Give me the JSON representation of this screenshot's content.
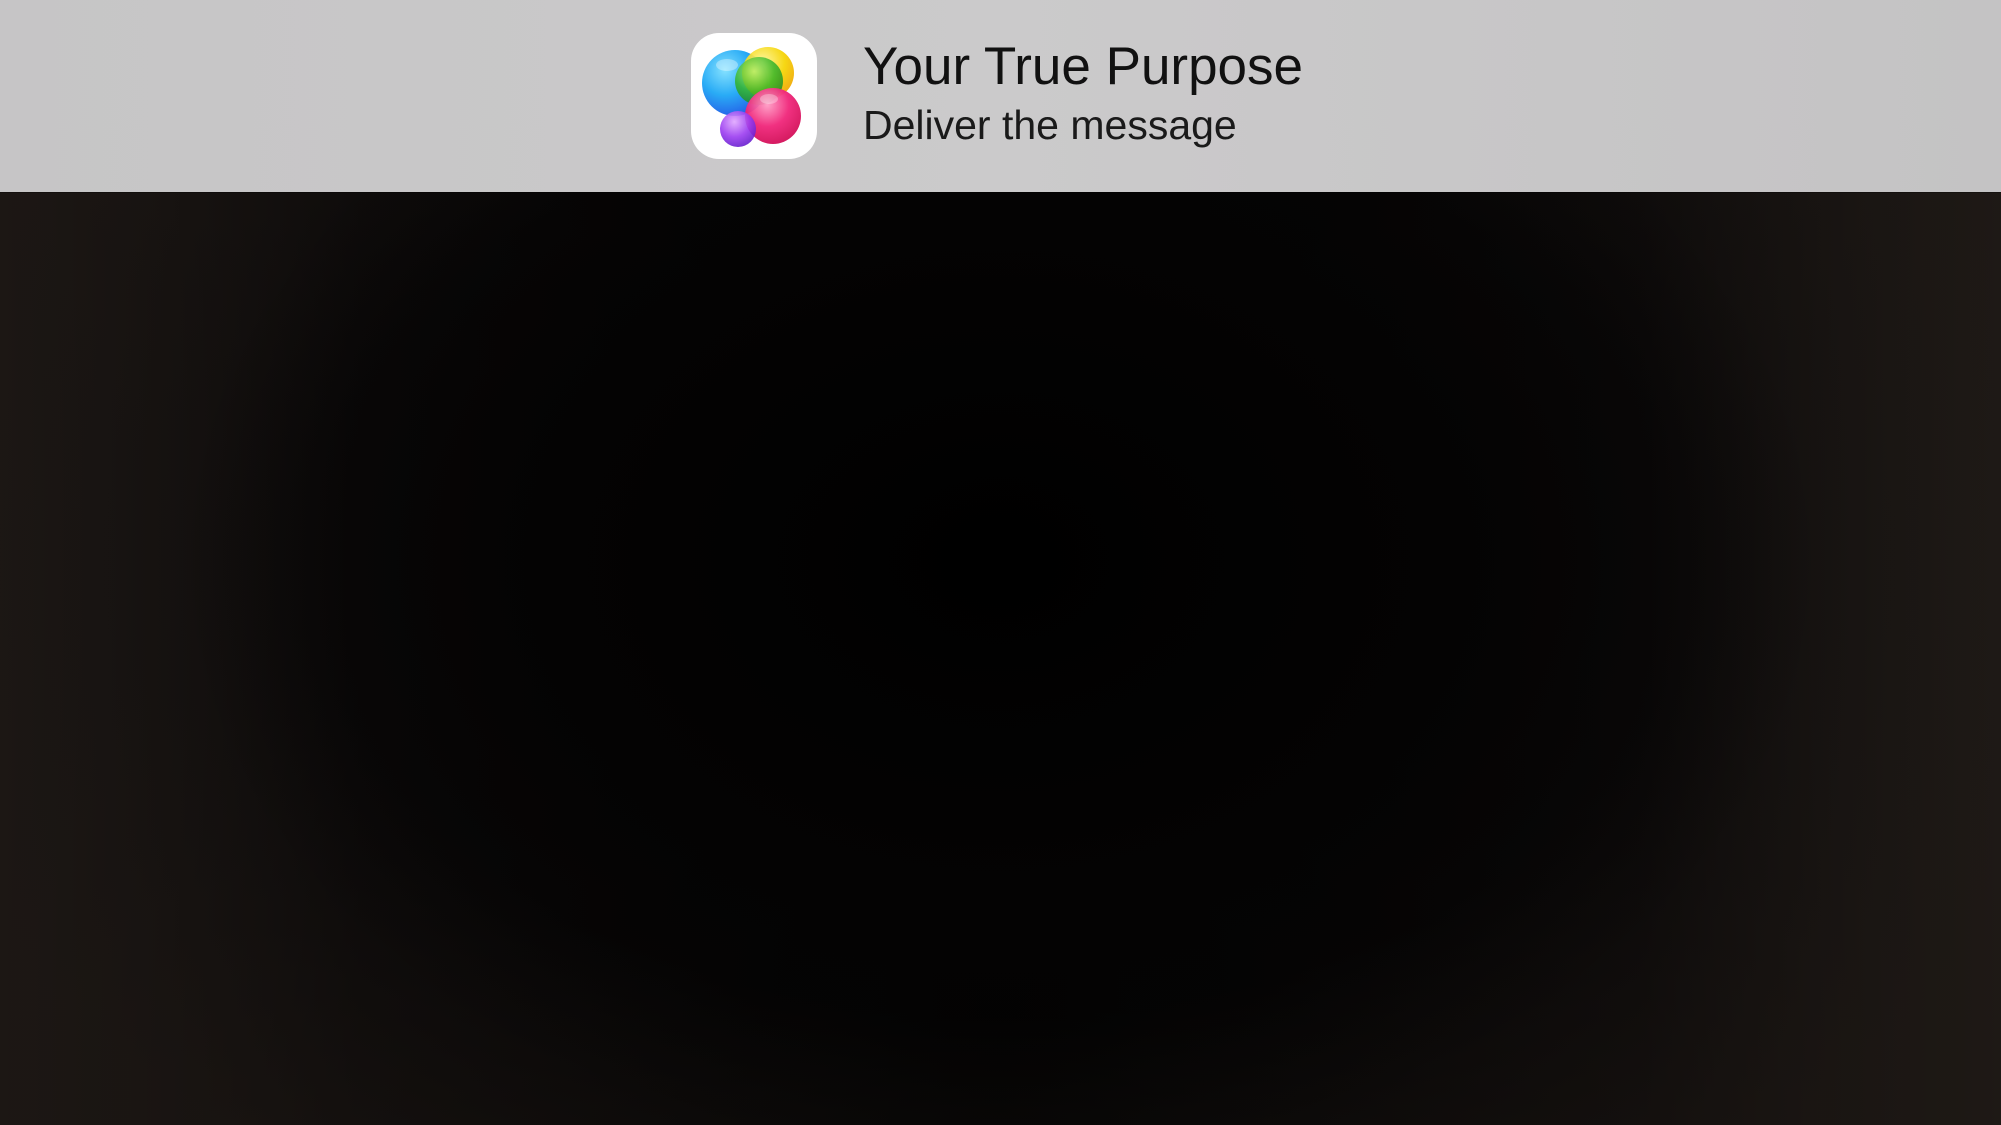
{
  "notification": {
    "app_icon": "game-center-icon",
    "title": "Your True Purpose",
    "message": "Deliver the message"
  },
  "colors": {
    "banner_background": "#c8c7c8",
    "screen_background": "#050404",
    "title_text": "#111111",
    "bubble_blue": "#1ea7f5",
    "bubble_green": "#35b52a",
    "bubble_yellow": "#f5d400",
    "bubble_pink": "#f0267a",
    "bubble_purple": "#9b3cf0"
  }
}
